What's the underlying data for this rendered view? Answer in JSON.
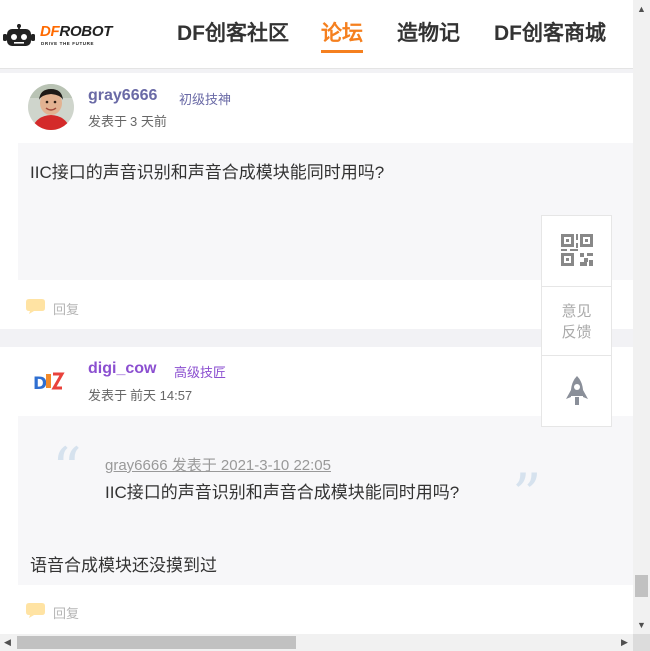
{
  "header": {
    "logo": {
      "brand_df": "DF",
      "brand_robot": "ROBOT",
      "tagline": "DRIVE THE FUTURE"
    },
    "nav": [
      {
        "label": "DF创客社区"
      },
      {
        "label": "论坛"
      },
      {
        "label": "造物记"
      },
      {
        "label": "DF创客商城"
      }
    ],
    "active_color": "#f5801f"
  },
  "posts": [
    {
      "username": "gray6666",
      "rank": "初级技神",
      "posted_label": "发表于",
      "posted_time": "3 天前",
      "content": "IIC接口的声音识别和声音合成模块能同时用吗?",
      "reply_label": "回复",
      "username_color": "#6a6aa6",
      "rank_color": "#6a6aa6"
    },
    {
      "username": "digi_cow",
      "rank": "高级技匠",
      "posted_label": "发表于",
      "posted_time": "前天 14:57",
      "quote": {
        "meta": "gray6666 发表于 2021-3-10 22:05",
        "text": "IIC接口的声音识别和声音合成模块能同时用吗?"
      },
      "content": "语音合成模块还没摸到过",
      "reply_label": "回复",
      "username_color": "#8b4fd0",
      "rank_color": "#8b4fd0"
    }
  ],
  "sidebar": {
    "items": [
      {
        "icon": "qr-code-icon"
      },
      {
        "label_line1": "意见",
        "label_line2": "反馈"
      },
      {
        "icon": "rocket-icon"
      }
    ]
  }
}
